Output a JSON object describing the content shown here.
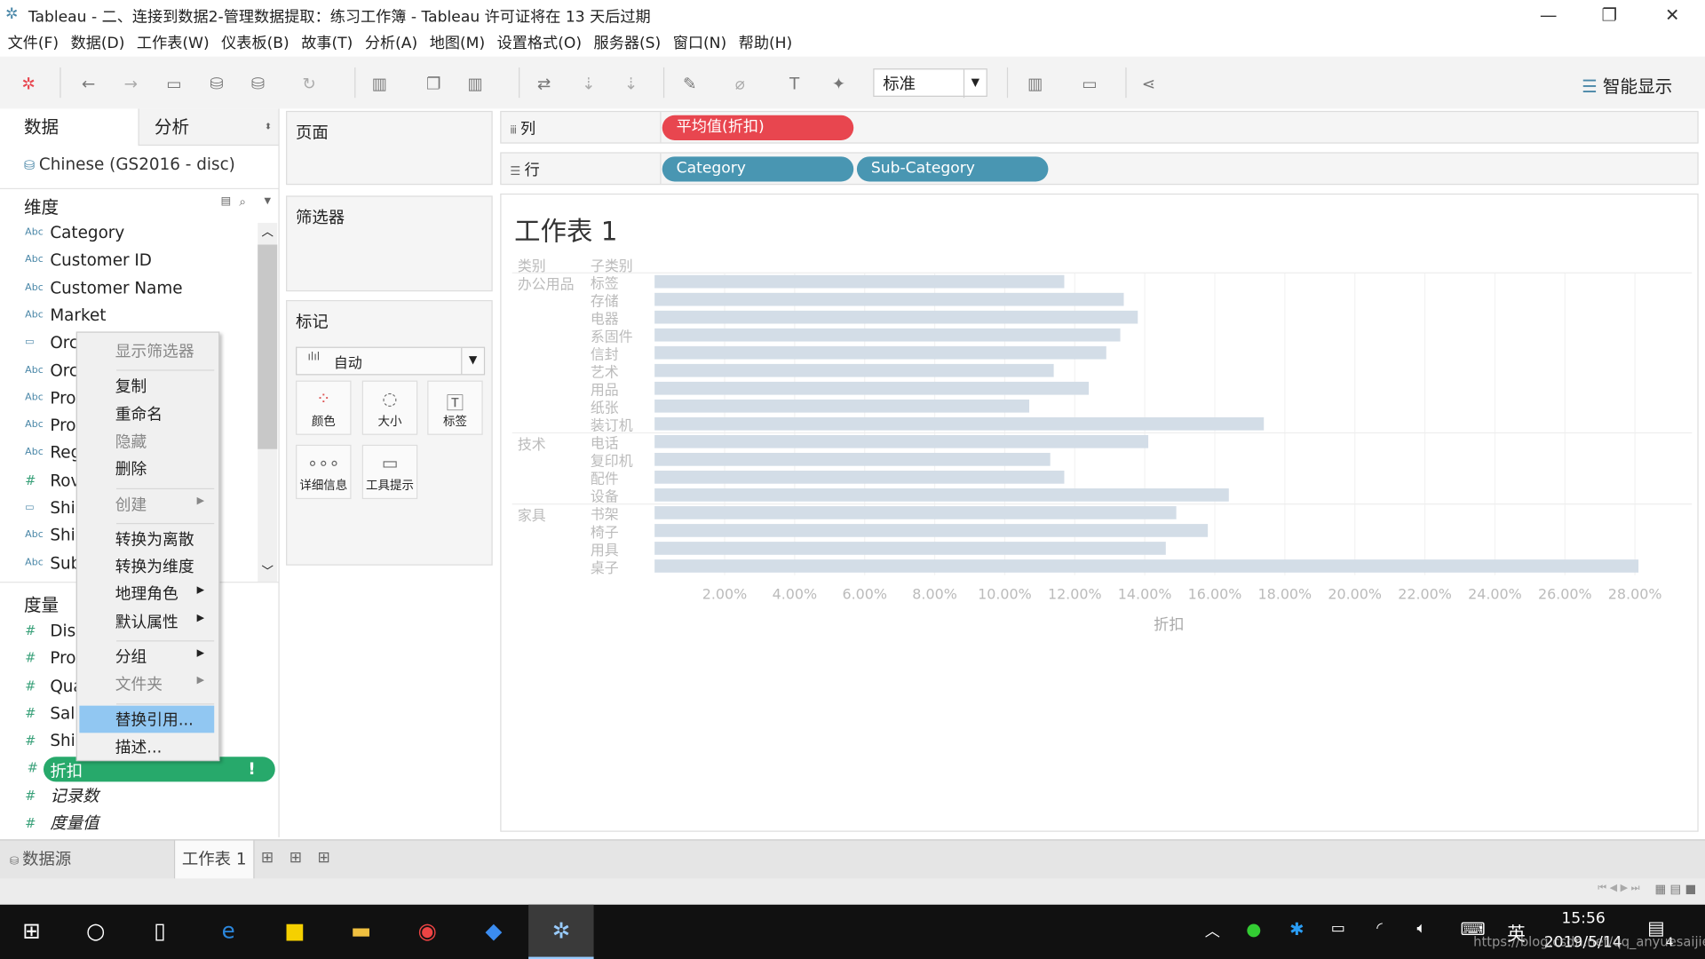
{
  "window": {
    "title": "Tableau - 二、连接到数据2-管理数据提取：练习工作簿 - Tableau 许可证将在 13 天后过期",
    "minimize": "—",
    "restore": "❐",
    "close": "✕"
  },
  "menu": [
    "文件(F)",
    "数据(D)",
    "工作表(W)",
    "仪表板(B)",
    "故事(T)",
    "分析(A)",
    "地图(M)",
    "设置格式(O)",
    "服务器(S)",
    "窗口(N)",
    "帮助(H)"
  ],
  "toolbar": {
    "fit_select": "标准",
    "smart_show": "智能显示"
  },
  "left_panel": {
    "tabs": [
      "数据",
      "分析"
    ],
    "datasource": "Chinese (GS2016 - disc)",
    "dimensions_header": "维度",
    "dimensions": [
      {
        "type": "Abc",
        "name": "Category"
      },
      {
        "type": "Abc",
        "name": "Customer ID"
      },
      {
        "type": "Abc",
        "name": "Customer Name"
      },
      {
        "type": "Abc",
        "name": "Market"
      },
      {
        "type": "date",
        "name": "Orc"
      },
      {
        "type": "Abc",
        "name": "Orc"
      },
      {
        "type": "Abc",
        "name": "Pro"
      },
      {
        "type": "Abc",
        "name": "Pro"
      },
      {
        "type": "Abc",
        "name": "Reg"
      },
      {
        "type": "#",
        "name": "Rov"
      },
      {
        "type": "date",
        "name": "Shi"
      },
      {
        "type": "Abc",
        "name": "Shi"
      },
      {
        "type": "Abc",
        "name": "Sub"
      }
    ],
    "measures_header": "度量",
    "measures": [
      {
        "name": "Dis"
      },
      {
        "name": "Pro"
      },
      {
        "name": "Qua"
      },
      {
        "name": "Sal"
      },
      {
        "name": "Shi"
      }
    ],
    "selected_measure": {
      "name": "折扣",
      "warning": "!",
      "color": "#27a96b"
    },
    "extra_measures": [
      "记录数",
      "度量值"
    ]
  },
  "context_menu": [
    {
      "label": "显示筛选器",
      "disabled": true
    },
    {
      "sep": true
    },
    {
      "label": "复制"
    },
    {
      "label": "重命名"
    },
    {
      "label": "隐藏",
      "disabled": true
    },
    {
      "label": "删除"
    },
    {
      "sep": true
    },
    {
      "label": "创建",
      "disabled": true,
      "sub": true
    },
    {
      "sep": true
    },
    {
      "label": "转换为离散"
    },
    {
      "label": "转换为维度"
    },
    {
      "label": "地理角色",
      "sub": true
    },
    {
      "label": "默认属性",
      "sub": true
    },
    {
      "sep": true
    },
    {
      "label": "分组",
      "sub": true
    },
    {
      "label": "文件夹",
      "disabled": true,
      "sub": true
    },
    {
      "sep": true
    },
    {
      "label": "替换引用...",
      "highlighted": true
    },
    {
      "label": "描述..."
    }
  ],
  "cards": {
    "pages": "页面",
    "filters": "筛选器",
    "marks": "标记",
    "mark_type": "自动",
    "mark_buttons": [
      "颜色",
      "大小",
      "标签",
      "详细信息",
      "工具提示"
    ]
  },
  "shelves": {
    "columns_label": "列",
    "rows_label": "行",
    "columns_pills": [
      {
        "label": "平均值(折扣)",
        "color": "#e8464f"
      }
    ],
    "rows_pills": [
      {
        "label": "Category",
        "color": "#4996b2"
      },
      {
        "label": "Sub-Category",
        "color": "#4996b2"
      }
    ]
  },
  "chart_data": {
    "type": "bar",
    "title": "工作表 1",
    "xlabel": "折扣",
    "row_headers": [
      "类别",
      "子类别"
    ],
    "bar_color": "#d3dde7",
    "groups": [
      {
        "category": "办公用品",
        "items": [
          [
            "标签",
            11.7
          ],
          [
            "存储",
            13.4
          ],
          [
            "电器",
            13.8
          ],
          [
            "系固件",
            13.3
          ],
          [
            "信封",
            12.9
          ],
          [
            "艺术",
            11.4
          ],
          [
            "用品",
            12.4
          ],
          [
            "纸张",
            10.7
          ],
          [
            "装订机",
            17.4
          ]
        ]
      },
      {
        "category": "技术",
        "items": [
          [
            "电话",
            14.1
          ],
          [
            "复印机",
            11.3
          ],
          [
            "配件",
            11.7
          ],
          [
            "设备",
            16.4
          ]
        ]
      },
      {
        "category": "家具",
        "items": [
          [
            "书架",
            14.9
          ],
          [
            "椅子",
            15.8
          ],
          [
            "用具",
            14.6
          ],
          [
            "桌子",
            28.1
          ]
        ]
      }
    ],
    "xlim": [
      0,
      29
    ],
    "xticks": [
      "2.00%",
      "4.00%",
      "6.00%",
      "8.00%",
      "10.00%",
      "12.00%",
      "14.00%",
      "16.00%",
      "18.00%",
      "20.00%",
      "22.00%",
      "24.00%",
      "26.00%",
      "28.00%"
    ]
  },
  "sheet_tabs": {
    "datasource": "数据源",
    "sheets": [
      "工作表 1"
    ]
  },
  "taskbar": {
    "time": "15:56",
    "date": "2019/5/14",
    "ime": "英",
    "notifications": "4",
    "watermark": "https://blog.csdn.net/qq_anyuesaijie"
  }
}
